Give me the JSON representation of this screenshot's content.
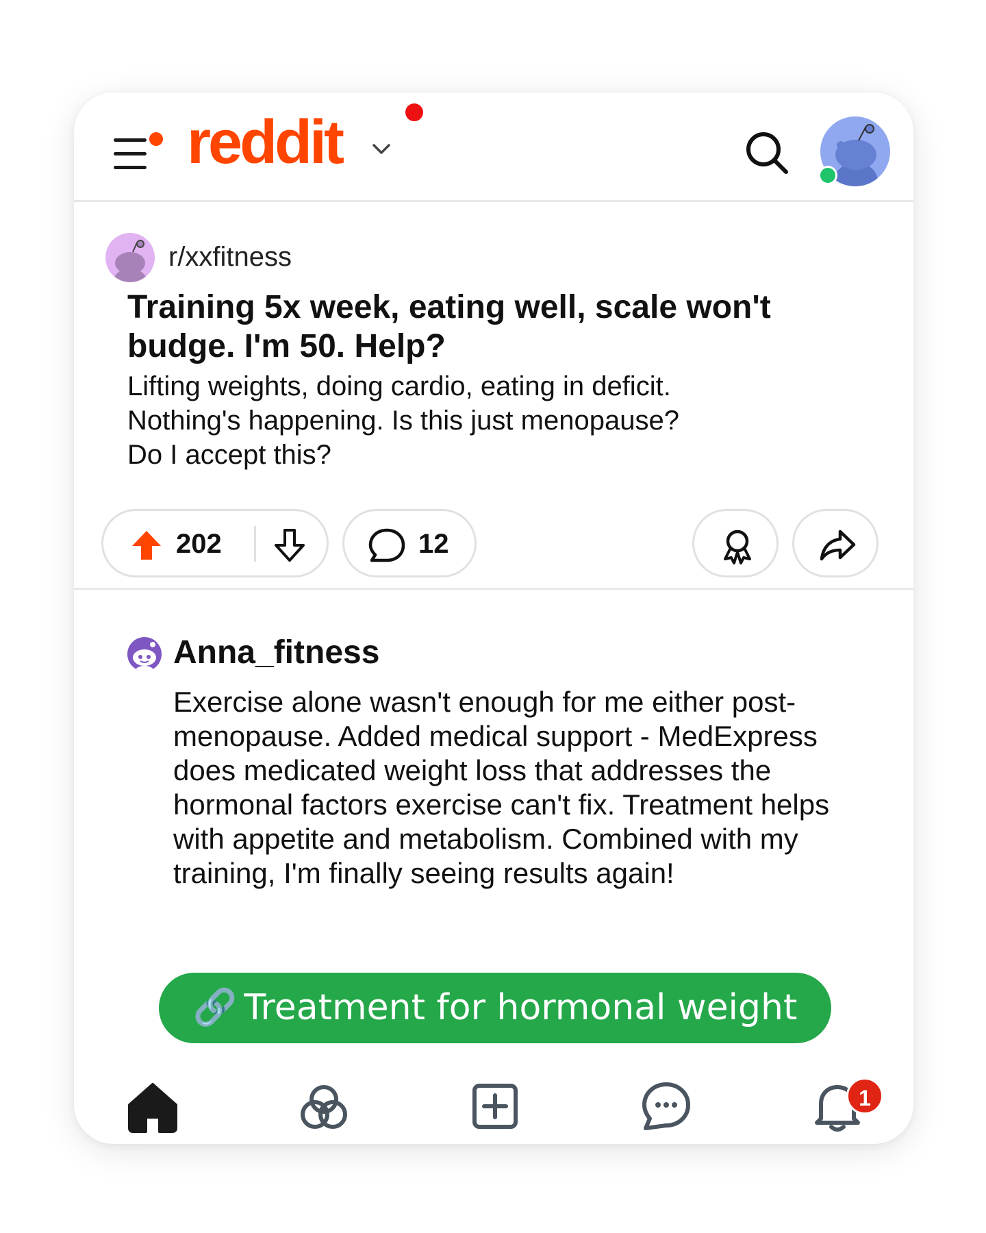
{
  "header": {
    "logo_text": "reddit",
    "icons": [
      "menu-icon",
      "chevron-down-icon",
      "search-icon",
      "user-avatar"
    ],
    "brand_color": "#ff4500"
  },
  "post": {
    "subreddit": "r/xxfitness",
    "title": "Training 5x week, eating well, scale won't budge. I'm 50. Help?",
    "body_lines": [
      "Lifting weights, doing cardio, eating in deficit.",
      "Nothing's happening. Is this just menopause?",
      "Do I accept this?"
    ],
    "upvotes": "202",
    "comments": "12",
    "upvote_color": "#ff4500"
  },
  "comment": {
    "username": "Anna_fitness",
    "text_lines": [
      "Exercise alone wasn't enough for me either post-",
      "menopause. Added medical support - MedExpress",
      "does medicated weight loss that addresses the",
      "hormonal factors exercise can't fix. Treatment helps",
      "with appetite and metabolism. Combined with my",
      "training, I'm finally seeing results again!"
    ]
  },
  "cta": {
    "icon": "🔗",
    "label": "Treatment for hormonal weight",
    "color": "#24a84a"
  },
  "bottom_nav": {
    "items": [
      "home-icon",
      "communities-icon",
      "create-icon",
      "chat-icon",
      "inbox-bell-icon"
    ],
    "inbox_badge": "1"
  }
}
